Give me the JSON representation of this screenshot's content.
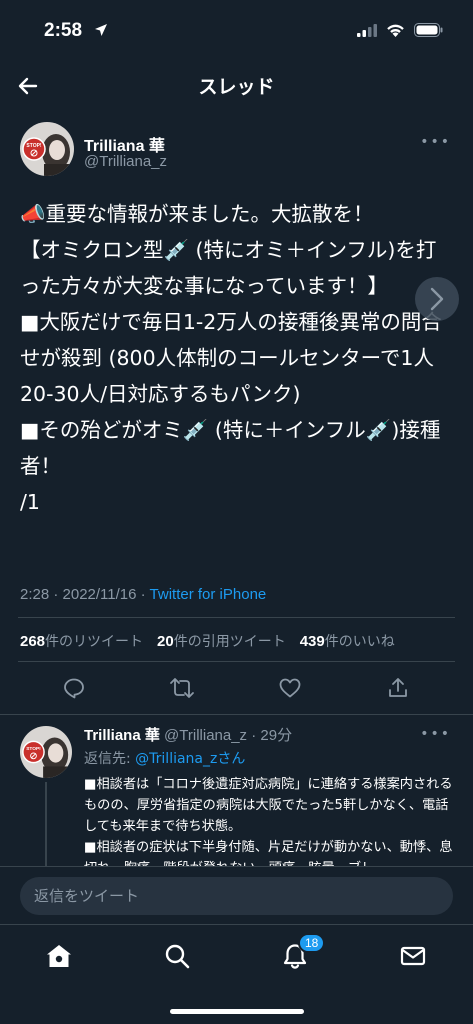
{
  "status_bar": {
    "time": "2:58"
  },
  "nav": {
    "title": "スレッド"
  },
  "tweet": {
    "author_name": "Trilliana 華",
    "author_handle": "@Trilliana_z",
    "avatar_stamp": "STOP!",
    "body": "📣重要な情報が来ました。大拡散を！\n【オミクロン型💉 (特にオミ＋インフル)を打った方々が大変な事になっています！】\n■大阪だけで毎日1-2万人の接種後異常の問合せが殺到 (800人体制のコールセンターで1人 20-30人/日対応するもパンク)\n■その殆どがオミ💉 (特に＋インフル💉)接種者！\n/1",
    "meta_time": "2:28 · 2022/11/16 · ",
    "meta_source": "Twitter for iPhone",
    "retweets_count": "268",
    "retweets_label": "件のリツイート",
    "quotes_count": "20",
    "quotes_label": "件の引用ツイート",
    "likes_count": "439",
    "likes_label": "件のいいね"
  },
  "reply": {
    "author_name": "Trilliana 華",
    "author_handle": "@Trilliana_z · 29分",
    "reply_to_prefix": "返信先: ",
    "reply_to_handle": "@Trilliana_zさん",
    "body": "■相談者は「コロナ後遺症対応病院」に連絡する様案内されるものの、厚労省指定の病院は大阪でたった5軒しかなく、電話しても来年まで待ち状態。\n■相談者の症状は下半身付随、片足だけが動かない、動悸、息切れ、胸痛、階段が登れない、頭痛、眩暈、ブレ"
  },
  "compose": {
    "placeholder": "返信をツイート"
  },
  "tabbar": {
    "notifications_badge": "18"
  },
  "colors": {
    "background": "#15202b",
    "accent": "#1d9bf0",
    "secondary_text": "#8b98a5",
    "divider": "#38444d"
  }
}
